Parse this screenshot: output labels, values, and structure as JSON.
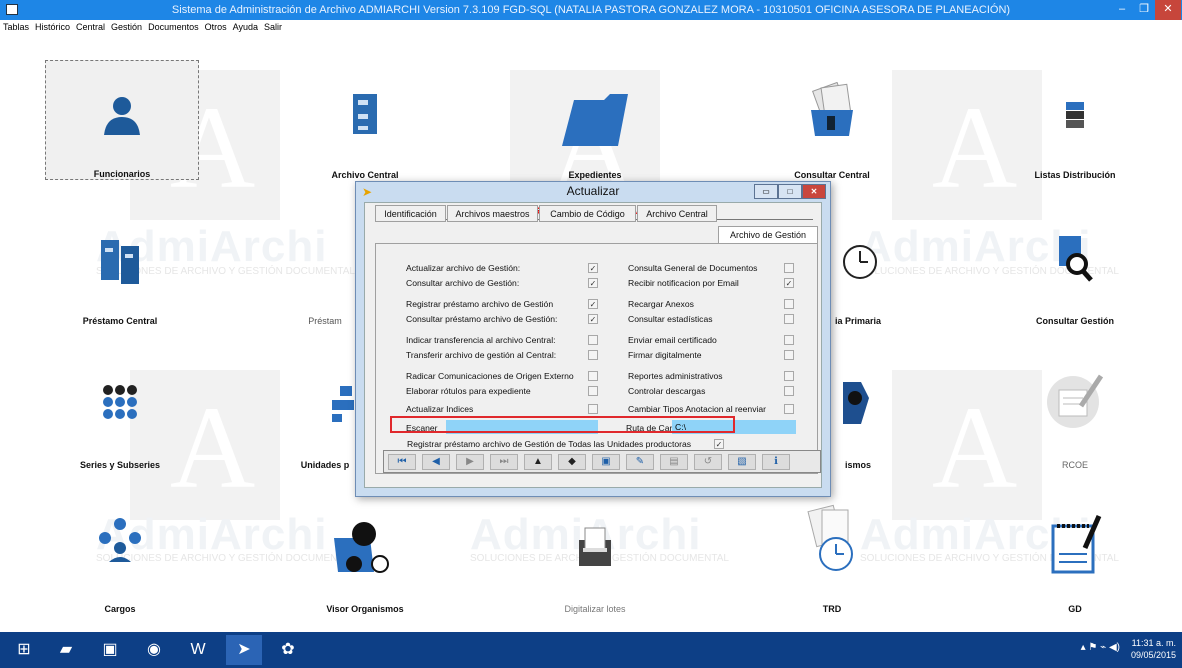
{
  "window": {
    "title": "Sistema de Administración de Archivo ADMIARCHI Version 7.3.109 FGD-SQL (NATALIA PASTORA GONZALEZ MORA - 10310501 OFICINA ASESORA DE PLANEACIÓN)",
    "min_label": "–",
    "max_label": "❐",
    "close_label": "✕"
  },
  "menu": [
    "Tablas",
    "Histórico",
    "Central",
    "Gestión",
    "Documentos",
    "Otros",
    "Ayuda",
    "Salir"
  ],
  "watermark": {
    "brand": "AdmiArchi",
    "sub": "SOLUCIONES DE ARCHIVO Y GESTIÓN DOCUMENTAL",
    "letter": "A"
  },
  "tiles": [
    {
      "label": "Funcionarios",
      "icon": "user-icon"
    },
    {
      "label": "Archivo Central",
      "icon": "cabinet-icon"
    },
    {
      "label": "Expedientes",
      "icon": "folder-icon"
    },
    {
      "label": "Consultar Central",
      "icon": "folder-docs-icon"
    },
    {
      "label": "Listas Distribución",
      "icon": "stack-icon"
    },
    {
      "label": "Préstamo Central",
      "icon": "cabinets-icon"
    },
    {
      "label": "Préstam",
      "icon": "loan-icon"
    },
    {
      "label": "ia Primaria",
      "icon": "clock-icon"
    },
    {
      "label": "Consultar Gestión",
      "icon": "magnifier-doc-icon"
    },
    {
      "label": "Series y Subseries",
      "icon": "dots-icon"
    },
    {
      "label": "Unidades p",
      "icon": "org-chart-icon"
    },
    {
      "label": "ismos",
      "icon": "org-icon"
    },
    {
      "label": "RCOE",
      "icon": "pen-doc-icon"
    },
    {
      "label": "Cargos",
      "icon": "people-icon"
    },
    {
      "label": "Visor Organismos",
      "icon": "binoculars-icon"
    },
    {
      "label": "Digitalizar lotes",
      "icon": "scanner-icon"
    },
    {
      "label": "TRD",
      "icon": "clock-docs-icon"
    },
    {
      "label": "GD",
      "icon": "notepad-icon"
    }
  ],
  "dialog": {
    "title": "Actualizar",
    "heading": "REGISTRO DE FUNCIONARIOS",
    "tabs": [
      "Identificación",
      "Archivos maestros",
      "Cambio de Código",
      "Archivo Central",
      "Archivo de Gestión"
    ],
    "active_tab": "Archivo de Gestión",
    "left_options": [
      {
        "label": "Actualizar archivo de Gestión:",
        "checked": true
      },
      {
        "label": "Consultar archivo de Gestión:",
        "checked": true
      },
      {
        "label": "Registrar préstamo archivo de Gestión",
        "checked": true
      },
      {
        "label": "Consultar préstamo archivo de Gestión:",
        "checked": true
      },
      {
        "label": "Indicar transferencia al archivo Central:",
        "checked": false
      },
      {
        "label": "Transferir archivo de gestión al Central:",
        "checked": false
      },
      {
        "label": "Radicar Comunicaciones de Origen Externo",
        "checked": false
      },
      {
        "label": "Elaborar rótulos para expediente",
        "checked": false
      },
      {
        "label": "Actualizar Indices",
        "checked": false
      }
    ],
    "right_options": [
      {
        "label": "Consulta General de Documentos",
        "checked": false
      },
      {
        "label": "Recibir notificacion por Email",
        "checked": true
      },
      {
        "label": "Recargar Anexos",
        "checked": false
      },
      {
        "label": "Consultar estadísticas",
        "checked": false
      },
      {
        "label": "Enviar email certificado",
        "checked": false
      },
      {
        "label": "Firmar digitalmente",
        "checked": false
      },
      {
        "label": "Reportes administrativos",
        "checked": false
      },
      {
        "label": "Controlar descargas",
        "checked": false
      },
      {
        "label": "Cambiar Tipos Anotacion al reenviar",
        "checked": false
      }
    ],
    "scanner_label": "Escaner",
    "scanner_value": "",
    "path_label": "Ruta de Carga",
    "path_value": "C:\\",
    "all_units_label": "Registrar préstamo archivo de Gestión de Todas las Unidades productoras",
    "all_units_checked": true,
    "toolbar": [
      "first",
      "prev",
      "next",
      "last",
      "find",
      "car",
      "save",
      "edit",
      "print",
      "undo",
      "delete",
      "help"
    ]
  },
  "taskbar": {
    "time": "11:31 a. m.",
    "date": "09/05/2015",
    "apps": [
      "windows-start",
      "file-explorer",
      "store",
      "chrome",
      "word",
      "admiarchi",
      "paint"
    ]
  }
}
